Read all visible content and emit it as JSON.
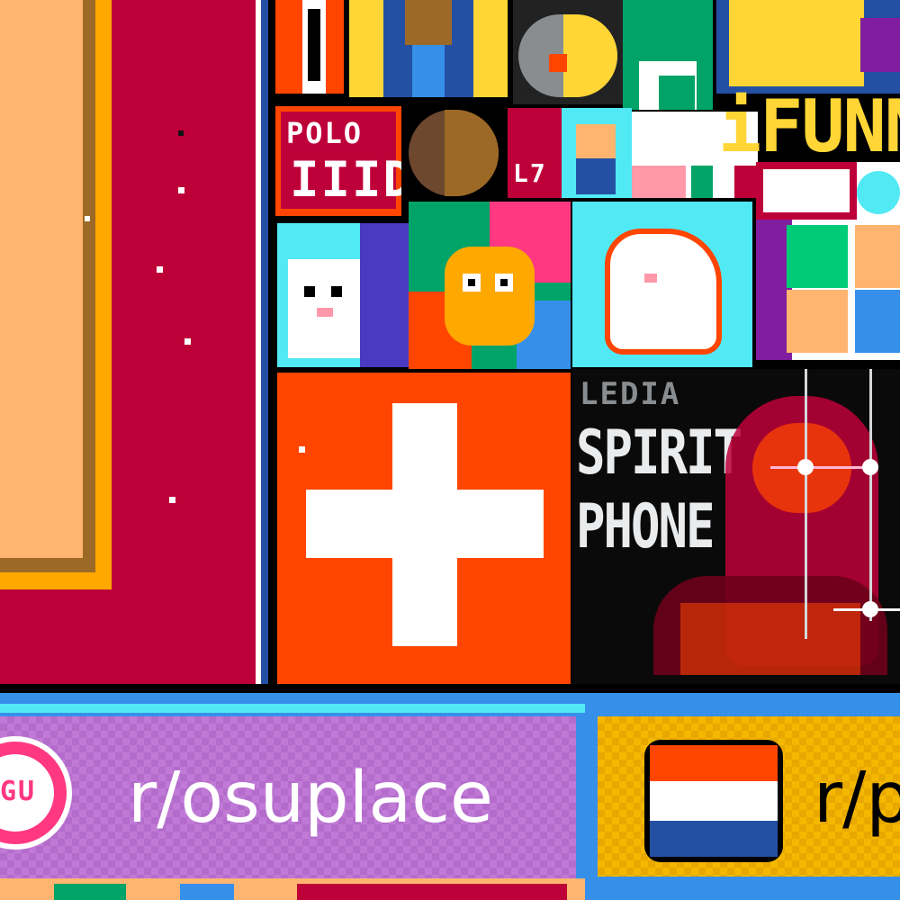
{
  "artworks": {
    "polo_text": "POLO",
    "polo_sub": "IIID",
    "ifunny_text": "iFUNN",
    "ledia_text": "LEDIA",
    "spirit_text": "SPIRIT",
    "phone_text": "PHONE",
    "osu_logo_text": "GU",
    "osu_banner_text": "r/osuplace",
    "nl_banner_text": "r/p"
  },
  "colors": {
    "crimson": "#be0039",
    "peach": "#ffb470",
    "brown": "#9c6926",
    "gold": "#ffa800",
    "swiss_red": "#ff4500",
    "white": "#ffffff",
    "purple": "#b44ac0",
    "sky": "#51e9f4",
    "blue": "#3690ea",
    "dark_red": "#6d001a"
  },
  "icons": [
    "swiss-flag",
    "netherlands-flag",
    "osu-logo",
    "squid-sprite",
    "unicorn-sprite",
    "cat-sprite"
  ]
}
